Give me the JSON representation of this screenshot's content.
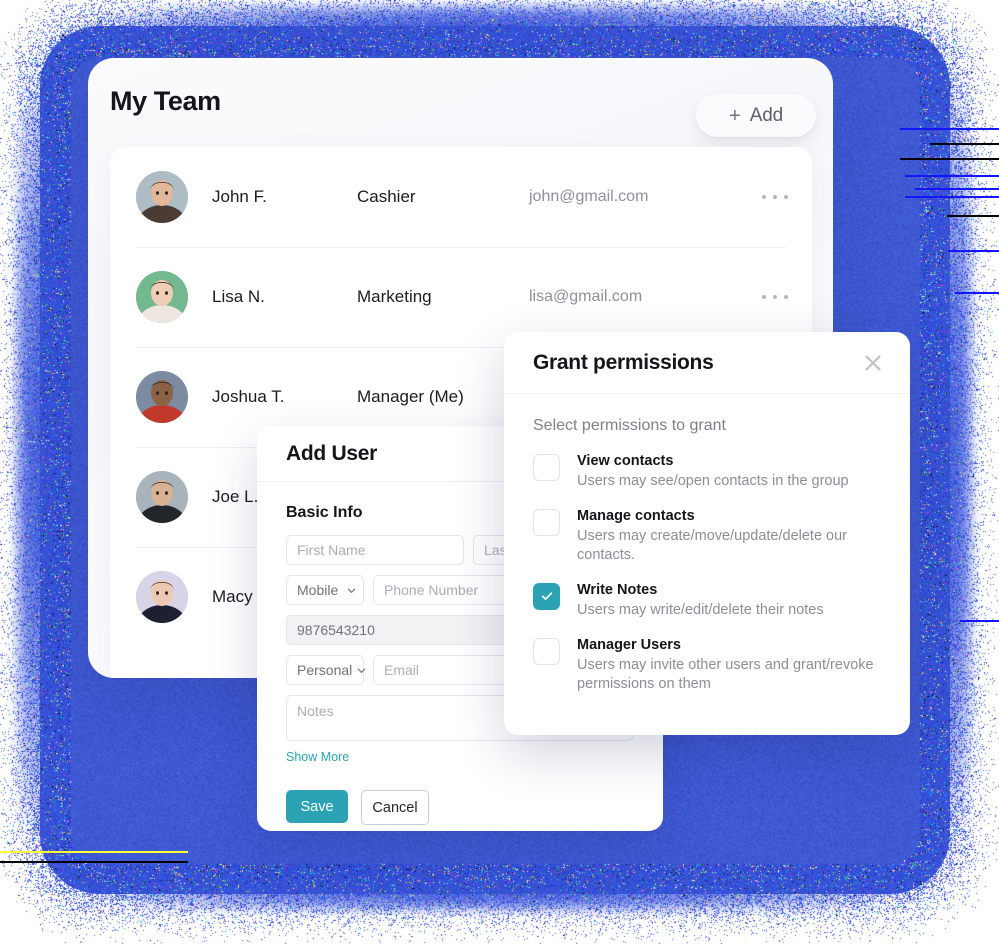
{
  "window": {
    "title": "My Team",
    "add_button": {
      "icon": "plus-icon",
      "label": "Add"
    }
  },
  "team": {
    "rows": [
      {
        "name": "John F.",
        "role": "Cashier",
        "email": "john@gmail.com",
        "menu": "more-options-icon",
        "avatar": "man-short-hair"
      },
      {
        "name": "Lisa N.",
        "role": "Marketing",
        "email": "lisa@gmail.com",
        "menu": "more-options-icon",
        "avatar": "woman-dark-hair"
      },
      {
        "name": "Joshua T.",
        "role": "Manager (Me)",
        "email": "",
        "menu": "more-options-icon",
        "avatar": "man-curly-hair"
      },
      {
        "name": "Joe L.",
        "role": "",
        "email": "",
        "menu": "more-options-icon",
        "avatar": "man-glasses"
      },
      {
        "name": "Macy",
        "role": "",
        "email": "",
        "menu": "more-options-icon",
        "avatar": "woman-long-hair"
      }
    ]
  },
  "add_user": {
    "title": "Add User",
    "section_title": "Basic Info",
    "first_name_placeholder": "First Name",
    "last_name_placeholder": "Last Name",
    "phone_type_value": "Mobile",
    "phone_placeholder": "Phone Number",
    "phone_secondary_value": "9876543210",
    "email_type_value": "Personal",
    "email_placeholder": "Email",
    "notes_placeholder": "Notes",
    "show_more_label": "Show More",
    "save_label": "Save",
    "cancel_label": "Cancel",
    "save_color": "#2ca3b5",
    "link_color": "#2ca3b5"
  },
  "grant_permissions": {
    "title": "Grant permissions",
    "close_icon": "close-icon",
    "subtitle": "Select permissions to grant",
    "accent_color": "#2ca3b5",
    "items": [
      {
        "label": "View contacts",
        "description": "Users may see/open contacts in the group",
        "checked": false
      },
      {
        "label": "Manage contacts",
        "description": "Users may create/move/update/delete our contacts.",
        "checked": false
      },
      {
        "label": "Write Notes",
        "description": "Users may write/edit/delete their notes",
        "checked": true
      },
      {
        "label": "Manager Users",
        "description": "Users may invite other users and grant/revoke permissions on them",
        "checked": false
      }
    ]
  },
  "background": {
    "glow_color": "#3a56d4",
    "accent_lines": [
      "#1414ff",
      "#000000",
      "#ffff33"
    ]
  }
}
